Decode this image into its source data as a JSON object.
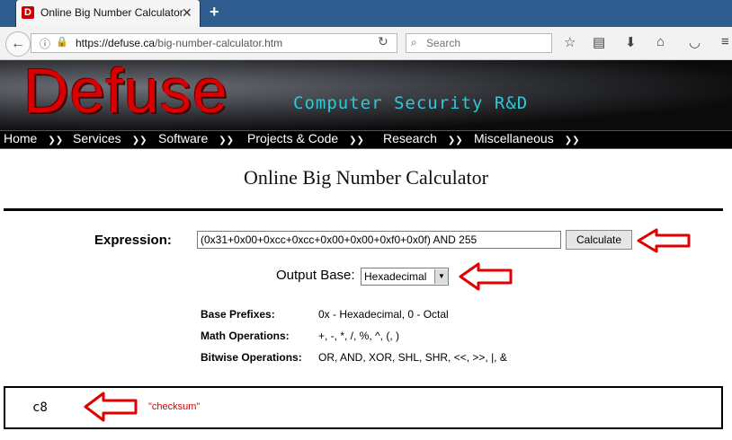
{
  "browser": {
    "tab_title": "Online Big Number Calculator",
    "tab_close": "✕",
    "new_tab": "+",
    "url_domain": "https://defuse.ca",
    "url_path": "/big-number-calculator.htm",
    "search_placeholder": "Search"
  },
  "site": {
    "logo": "Defuse",
    "tagline": "Computer Security R&D",
    "nav": [
      "Home",
      "Services",
      "Software",
      "Projects & Code",
      "Research",
      "Miscellaneous"
    ]
  },
  "page": {
    "title": "Online Big Number Calculator",
    "expression_label": "Expression:",
    "expression_value": "(0x31+0x00+0xcc+0xcc+0x00+0x00+0xf0+0x0f) AND 255",
    "calculate_label": "Calculate",
    "output_base_label": "Output Base:",
    "output_base_value": "Hexadecimal",
    "info": [
      {
        "label": "Base Prefixes:",
        "value": "0x - Hexadecimal, 0 - Octal"
      },
      {
        "label": "Math Operations:",
        "value": "+, -, *, /, %, ^, (, )"
      },
      {
        "label": "Bitwise Operations:",
        "value": "OR, AND, XOR, SHL, SHR, <<, >>, |, &"
      }
    ],
    "result": "c8",
    "annotation": "\"checksum\""
  },
  "colors": {
    "arrow": "#e00000",
    "tagline": "#2ec8d6",
    "logo": "#d80000"
  }
}
